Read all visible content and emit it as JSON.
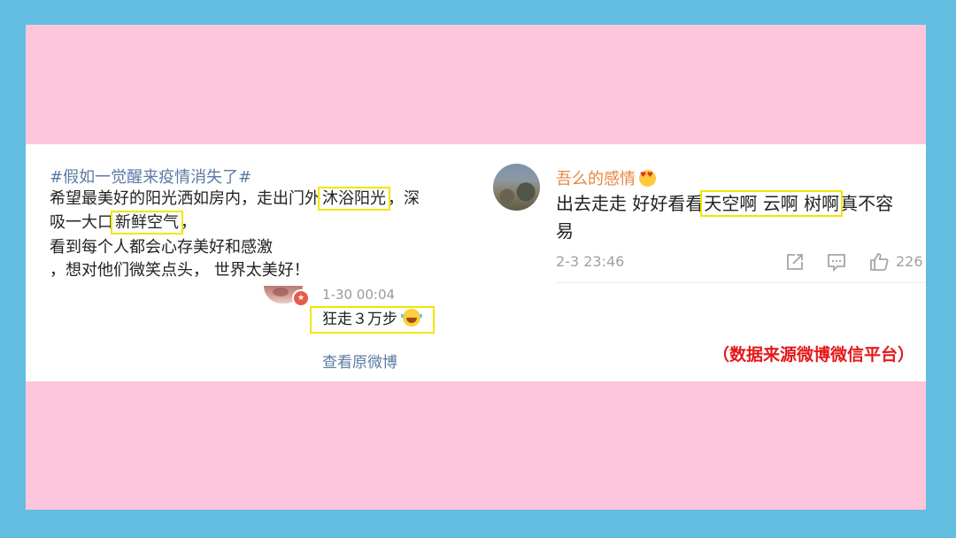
{
  "left_post": {
    "hashtag": "#假如一觉醒来疫情消失了#",
    "line1_pre": "希望最美好的阳光洒如房内，走出门外",
    "line1_hl": "沐浴阳光",
    "line1_post": "，深",
    "line2_pre": "吸一大口",
    "line2_hl": "新鲜空气",
    "line2_post": "，",
    "line3": "看到每个人都会心存美好和感激",
    "line4": "，想对他们微笑点头， 世界太美好！",
    "reply_time": "1-30 00:04",
    "reply_text": "狂走３万步",
    "view_original": "查看原微博"
  },
  "right_comment": {
    "commenter": "吾么的感情",
    "line1_pre": "出去走走 好好看看",
    "line1_hl": "天空啊 云啊 树啊",
    "line1_post": "真不容",
    "line2": "易",
    "date": "2-3 23:46",
    "like_count": "226"
  },
  "source_note": "（数据来源微博微信平台）",
  "colors": {
    "outer_bg": "#63bde0",
    "panel_pink": "#fec6dd",
    "highlight": "#f1e600",
    "link_blue": "#5c7aa6",
    "name_orange": "#e8853e",
    "source_red": "#e4181a"
  },
  "icons": [
    "share-icon",
    "comment-icon",
    "like-icon",
    "laugh-emoji",
    "love-eyes-emoji",
    "vip-badge-icon"
  ]
}
